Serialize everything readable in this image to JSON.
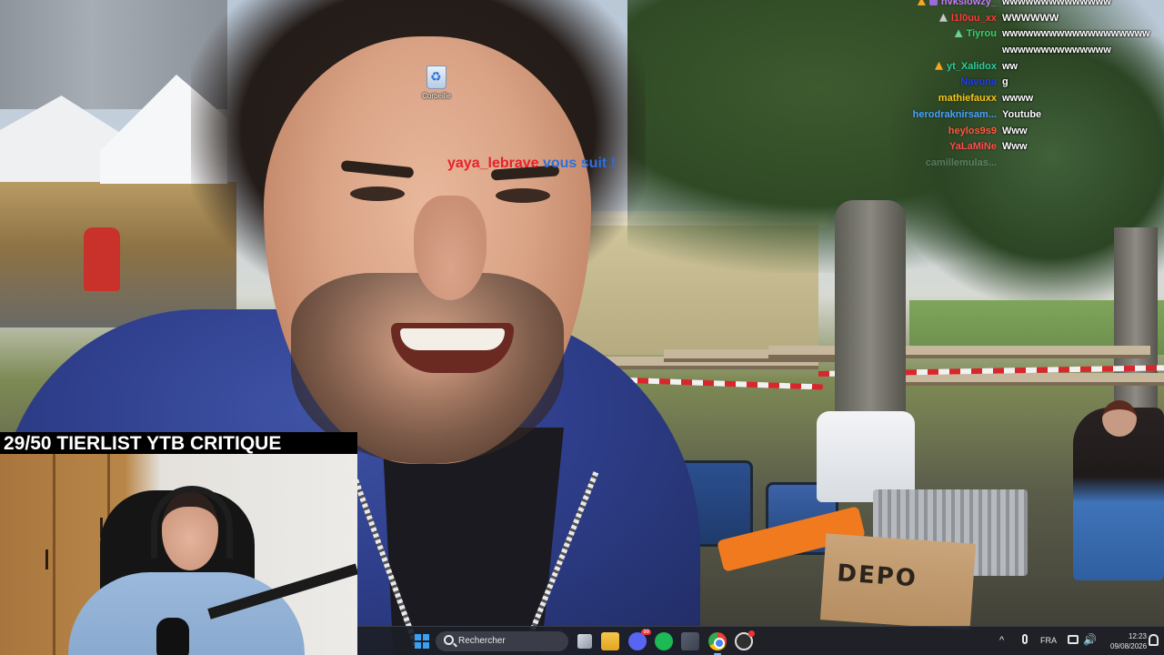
{
  "desktop": {
    "recycle_bin_label": "Corbeille"
  },
  "alert": {
    "username": "yaya_lebrave",
    "message": " vous suit !"
  },
  "chat": {
    "messages": [
      {
        "user": "hvkslowzy_",
        "text": "wwwwwwwwwwwwww",
        "color": "#c77dff",
        "badge": "cone+gem"
      },
      {
        "user": "l1l0uu_xx",
        "text": "WWWWWW",
        "color": "#ff3b3b",
        "badge": "grey"
      },
      {
        "user": "Tiyrou",
        "text": "wwwwwwwwwwwwwwwwwww",
        "color": "#3bd16f",
        "badge": "greencone"
      },
      {
        "user": "",
        "text": "wwwwwwwwwwwwww",
        "color": "#ffffff",
        "badge": ""
      },
      {
        "user": "yt_Xalidox",
        "text": "ww",
        "color": "#2ecc9a",
        "badge": "cone"
      },
      {
        "user": "Navona",
        "text": "g",
        "color": "#1e3cff",
        "badge": ""
      },
      {
        "user": "mathiefauxx",
        "text": "wwww",
        "color": "#f5c518",
        "badge": ""
      },
      {
        "user": "herodraknirsam...",
        "text": "Youtube",
        "color": "#4aa3ff",
        "badge": ""
      },
      {
        "user": "heylos9s9",
        "text": "Www",
        "color": "#ff5a3c",
        "badge": ""
      },
      {
        "user": "YaLaMiNe",
        "text": "Www",
        "color": "#ff4d4d",
        "badge": ""
      },
      {
        "user": "camillemulas...",
        "text": "",
        "color": "#9fd8c8",
        "badge": "faded"
      }
    ]
  },
  "webcam": {
    "title": "29/50 TIERLIST YTB CRITIQUE"
  },
  "scene": {
    "box_label": "DEPO"
  },
  "taskbar": {
    "search_placeholder": "Rechercher",
    "discord_badge": "99",
    "tray_chevron": "^",
    "tray_volume": "🔊",
    "language": "FRA",
    "time": "12:23",
    "date": "09/08/2026"
  }
}
